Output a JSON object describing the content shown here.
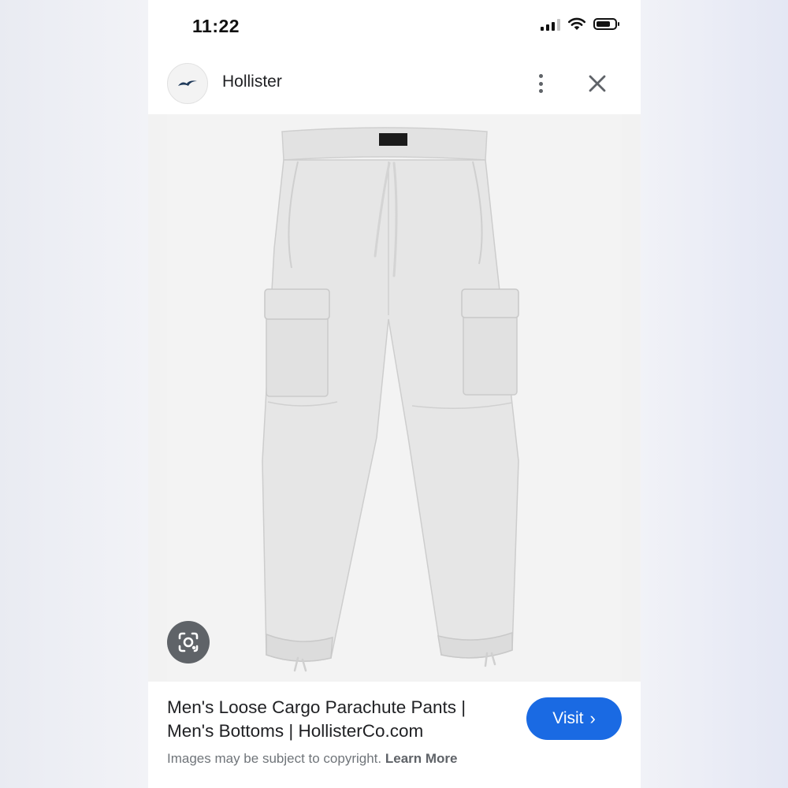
{
  "status_bar": {
    "time": "11:22"
  },
  "header": {
    "site_name": "Hollister",
    "favicon_icon": "seagull-logo-icon",
    "menu_icon": "more-vert-icon",
    "close_icon": "close-icon"
  },
  "image": {
    "alt": "Men's Loose Cargo Parachute Pants",
    "lens_icon": "google-lens-icon"
  },
  "result": {
    "title": "Men's Loose Cargo Parachute Pants | Men's Bottoms | HollisterCo.com",
    "visit_label": "Visit",
    "copyright_text": "Images may be subject to copyright.",
    "learn_more_label": "Learn More"
  },
  "colors": {
    "accent": "#1a6ae3",
    "pants": "#e6e6e6",
    "image_bg": "#f2f2f2"
  }
}
